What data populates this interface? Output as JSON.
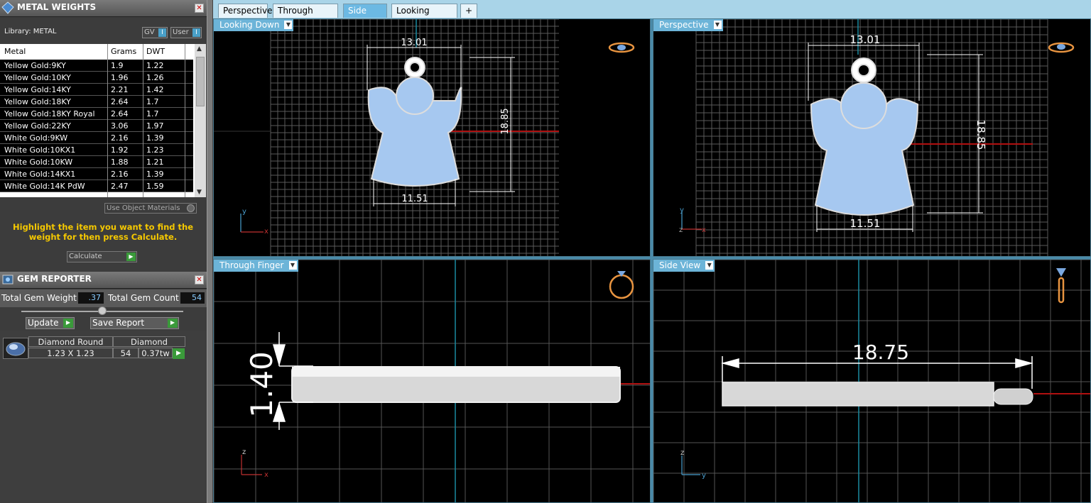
{
  "metal_panel": {
    "title": "METAL WEIGHTS",
    "library_label": "Library: METAL",
    "toggle_gv": "GV",
    "toggle_user": "User",
    "toggle_indicator": "I",
    "columns": [
      "Metal",
      "Grams",
      "DWT"
    ],
    "rows": [
      {
        "metal": "Yellow Gold:9KY",
        "grams": "1.9",
        "dwt": "1.22"
      },
      {
        "metal": "Yellow Gold:10KY",
        "grams": "1.96",
        "dwt": "1.26"
      },
      {
        "metal": "Yellow Gold:14KY",
        "grams": "2.21",
        "dwt": "1.42"
      },
      {
        "metal": "Yellow Gold:18KY",
        "grams": "2.64",
        "dwt": "1.7"
      },
      {
        "metal": "Yellow Gold:18KY Royal",
        "grams": "2.64",
        "dwt": "1.7"
      },
      {
        "metal": "Yellow Gold:22KY",
        "grams": "3.06",
        "dwt": "1.97"
      },
      {
        "metal": "White Gold:9KW",
        "grams": "2.16",
        "dwt": "1.39"
      },
      {
        "metal": "White Gold:10KX1",
        "grams": "1.92",
        "dwt": "1.23"
      },
      {
        "metal": "White Gold:10KW",
        "grams": "1.88",
        "dwt": "1.21"
      },
      {
        "metal": "White Gold:14KX1",
        "grams": "2.16",
        "dwt": "1.39"
      },
      {
        "metal": "White Gold:14K PdW",
        "grams": "2.47",
        "dwt": "1.59"
      }
    ],
    "use_object_materials": "Use Object Materials",
    "hint": "Highlight the item you want to find the weight for then press Calculate.",
    "calculate": "Calculate"
  },
  "gem_panel": {
    "title": "GEM REPORTER",
    "total_weight_label": "Total Gem Weight",
    "total_weight_value": ".37",
    "total_count_label": "Total Gem Count",
    "total_count_value": "54",
    "update": "Update",
    "save_report": "Save Report",
    "gem": {
      "cut": "Diamond Round",
      "size": "1.23 X 1.23",
      "material": "Diamond",
      "count": "54",
      "weight": "0.37tw"
    }
  },
  "tabs": [
    "Perspective",
    "Through Finger",
    "Side View",
    "Looking Down"
  ],
  "active_tab": "Side View",
  "add_tab_icon": "plus-icon",
  "viewports": {
    "top_left": {
      "label": "Looking Down",
      "dim_width": "13.01",
      "dim_height": "18.85",
      "dim_bottom": "11.51",
      "axis_v": "y",
      "axis_h": "x",
      "nav_icon": "ring-top-icon"
    },
    "top_right": {
      "label": "Perspective",
      "dim_width": "13.01",
      "dim_height": "18.85",
      "dim_bottom": "11.51",
      "axis_v": "y",
      "axis_h": "x",
      "axis_z": "z",
      "nav_icon": "ring-perspective-icon"
    },
    "bottom_left": {
      "label": "Through Finger",
      "dim_thickness": "1.40",
      "axis_v": "z",
      "axis_h": "x",
      "nav_icon": "ring-front-icon"
    },
    "bottom_right": {
      "label": "Side View",
      "dim_length": "18.75",
      "axis_v": "z",
      "axis_h": "y",
      "nav_icon": "ring-side-icon"
    }
  },
  "colors": {
    "viewport_label": "#6cb4d8",
    "tab_active": "#6cb9e3",
    "gem_blue": "#a6c8f0",
    "hint_text": "#f5c800",
    "axis_red": "#c01818"
  }
}
